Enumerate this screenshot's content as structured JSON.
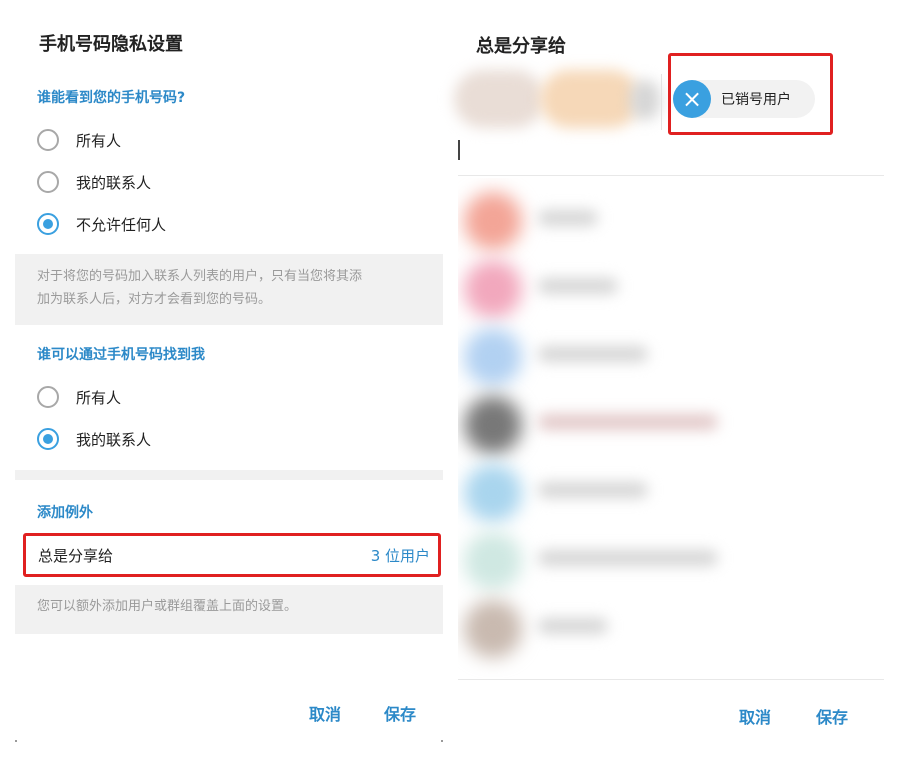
{
  "left": {
    "title": "手机号码隐私设置",
    "who_can_see": {
      "heading": "谁能看到您的手机号码?",
      "options": [
        "所有人",
        "我的联系人",
        "不允许任何人"
      ],
      "selected_index": 2,
      "note_line1": "对于将您的号码加入联系人列表的用户，只有当您将其添",
      "note_line2": "加为联系人后，对方才会看到您的号码。"
    },
    "who_can_find": {
      "heading": "谁可以通过手机号码找到我",
      "options": [
        "所有人",
        "我的联系人"
      ],
      "selected_index": 1
    },
    "exceptions": {
      "heading": "添加例外",
      "always_share_label": "总是分享给",
      "always_share_count": "3 位用户",
      "note": "您可以额外添加用户或群组覆盖上面的设置。"
    },
    "buttons": {
      "cancel": "取消",
      "save": "保存"
    }
  },
  "right": {
    "title": "总是分享给",
    "chip": {
      "name": "已销号用户",
      "icon": "close-icon"
    },
    "buttons": {
      "cancel": "取消",
      "save": "保存"
    }
  },
  "colors": {
    "accent": "#2c89c8",
    "radio": "#3aa0e0",
    "highlight": "#e02020",
    "note_bg": "#f1f1f1"
  }
}
